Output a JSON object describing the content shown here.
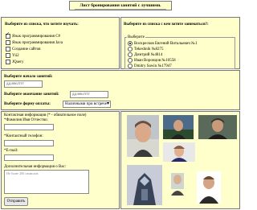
{
  "title": "Лист бронирования занятий с лучшими.",
  "courses": {
    "heading": "Выберите из списка, что хотите изучать:",
    "items": [
      {
        "label": "Язык программирования C#",
        "checked": true
      },
      {
        "label": "Язык программирования Java",
        "checked": false
      },
      {
        "label": "Создание сайтов",
        "checked": false
      },
      {
        "label": "Yii2",
        "checked": false
      },
      {
        "label": "JQuery",
        "checked": false
      }
    ]
  },
  "teachers": {
    "heading": "Выберите из списка с кем хотите заниматься?:",
    "legend": "Выберите",
    "items": [
      {
        "label": "Воскресков Евгений Витальевич №1",
        "selected": true
      },
      {
        "label": "Tekeshnik №8275",
        "selected": false
      },
      {
        "label": "Дмитрий №4814",
        "selected": false
      },
      {
        "label": "Иван Воронцов №10558",
        "selected": false
      },
      {
        "label": "Dmitry Sawin №17947",
        "selected": false
      }
    ]
  },
  "schedule": {
    "start_label": "Выберите начало занятий:",
    "start_placeholder": "дд.мм.гггг",
    "end_label": "Выберите окончание занятий:",
    "end_placeholder": "дд.мм.гггг",
    "payment_label": "Выберите форму оплаты:",
    "payment_value": "Наличными при встрече"
  },
  "contact": {
    "heading": "Контактная информация (* - обязательное поле)",
    "name_label": "*Фамилия Имя Отчество:",
    "phone_label": "*Контактный телефон:",
    "email_label": "*E-mail:",
    "extra_label": "Дополнительная информация о Вас:",
    "extra_placeholder": "Не более 200 символов",
    "submit_label": "Отправить"
  },
  "colors": {
    "panel_bg": "#ffffcc",
    "border": "#777777"
  }
}
